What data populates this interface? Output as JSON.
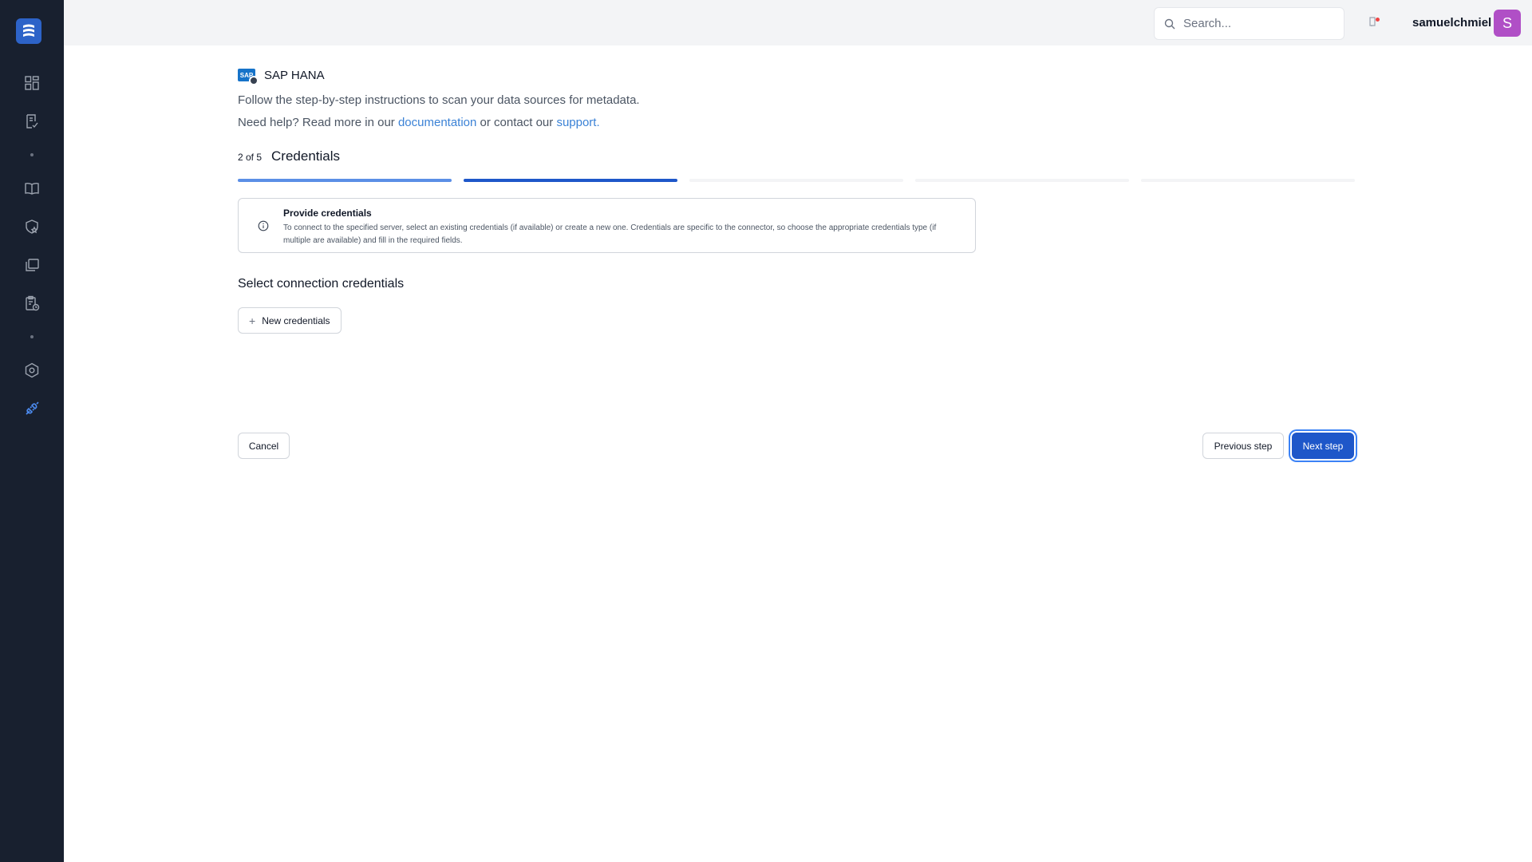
{
  "header": {
    "search_placeholder": "Search...",
    "username": "samuelchmiel",
    "avatar_initial": "S"
  },
  "connector": {
    "logo_text": "SAP",
    "name": "SAP HANA"
  },
  "intro": {
    "line1": "Follow the step-by-step instructions to scan your data sources for metadata.",
    "help_prefix": "Need help? Read more in our",
    "documentation_link": "documentation",
    "help_middle": "or contact our",
    "support_link": "support."
  },
  "wizard": {
    "step_count": "2 of 5",
    "step_title": "Credentials",
    "current_step": 2,
    "total_steps": 5
  },
  "info": {
    "title": "Provide credentials",
    "text": "To connect to the specified server, select an existing credentials (if available) or create a new one. Credentials are specific to the connector, so choose the appropriate credentials type (if multiple are available) and fill in the required fields."
  },
  "credentials": {
    "section_title": "Select connection credentials",
    "new_button": "New credentials"
  },
  "footer": {
    "cancel": "Cancel",
    "previous": "Previous step",
    "next": "Next step"
  },
  "colors": {
    "sidebar": "#18202f",
    "primary": "#1e57c9",
    "link": "#3b82d6",
    "avatar": "#b04fc6",
    "progress_done": "#5b8fe6",
    "progress_active": "#1e57c9",
    "progress_pending": "#f3f4f6"
  }
}
